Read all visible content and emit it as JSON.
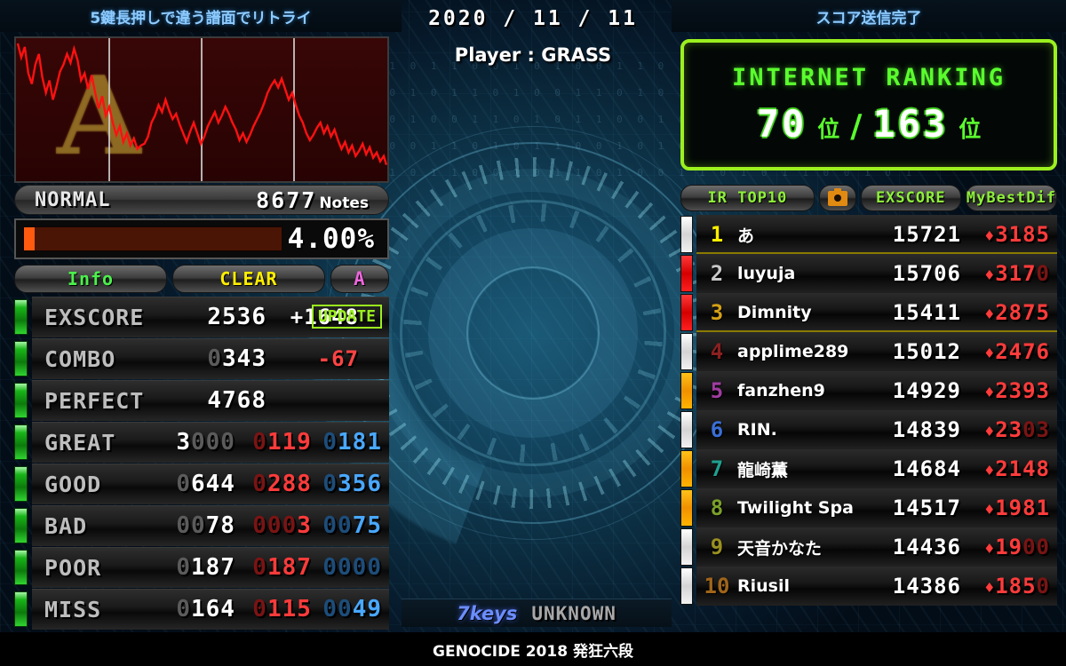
{
  "left": {
    "banner": "5鍵長押しで違う譜面でリトライ",
    "graph": {
      "grade_letter": "A",
      "gauge_type": "NORMAL",
      "notes_count": "8677",
      "notes_label": "Notes",
      "percent": "4.00%",
      "percent_fill": 4.0
    },
    "tabs": {
      "info": "Info",
      "clear": "CLEAR",
      "rank": "A"
    },
    "stats": [
      {
        "label": "EXSCORE",
        "value": "2536",
        "value_dim": "",
        "diff": "+1648",
        "diff_sign": "plus",
        "red": "",
        "red_dim": "",
        "blue": "",
        "blue_dim": "",
        "badge": "UPDATE"
      },
      {
        "label": "COMBO",
        "value": "343",
        "value_dim": "0",
        "diff": "-67",
        "diff_sign": "minus",
        "red": "",
        "red_dim": "",
        "blue": "",
        "blue_dim": "",
        "badge": ""
      },
      {
        "label": "PERFECT",
        "value": "4768",
        "value_dim": "",
        "diff": "",
        "diff_sign": "",
        "red": "",
        "red_dim": "",
        "blue": "",
        "blue_dim": "",
        "badge": ""
      },
      {
        "label": "GREAT",
        "value": "3",
        "value_dim": "",
        "value_dim_after": "000",
        "diff": "",
        "diff_sign": "",
        "red": "119",
        "red_dim": "0",
        "blue": "181",
        "blue_dim": "0",
        "badge": ""
      },
      {
        "label": "GOOD",
        "value": "644",
        "value_dim": "0",
        "diff": "",
        "diff_sign": "",
        "red": "288",
        "red_dim": "0",
        "blue": "356",
        "blue_dim": "0",
        "badge": ""
      },
      {
        "label": "BAD",
        "value": "78",
        "value_dim": "00",
        "diff": "",
        "diff_sign": "",
        "red": "3",
        "red_dim": "000",
        "blue": "75",
        "blue_dim": "00",
        "badge": ""
      },
      {
        "label": "POOR",
        "value": "187",
        "value_dim": "0",
        "diff": "",
        "diff_sign": "",
        "red": "187",
        "red_dim": "0",
        "blue": "",
        "blue_dim": "0000",
        "badge": ""
      },
      {
        "label": "MISS",
        "value": "164",
        "value_dim": "0",
        "diff": "",
        "diff_sign": "",
        "red": "115",
        "red_dim": "0",
        "blue": "49",
        "blue_dim": "00",
        "badge": ""
      }
    ]
  },
  "center": {
    "date": "2020 / 11 / 11",
    "player": "Player : GRASS",
    "keys": "7keys",
    "difficulty": "UNKNOWN",
    "song_title": "GENOCIDE 2018 発狂六段"
  },
  "right": {
    "banner": "スコア送信完了",
    "internet_ranking": {
      "title": "INTERNET RANKING",
      "my_rank": "70",
      "total": "163",
      "unit": "位",
      "separator": "/"
    },
    "ir_header": {
      "top10": "IR TOP10",
      "camera": "camera-icon",
      "exscore": "EXSCORE",
      "mybestdif": "MyBestDif"
    },
    "ranking": [
      {
        "rank": "1",
        "name": "あ",
        "score": "15721",
        "dif": "3185",
        "dif_dim": "",
        "bar": "cb-white",
        "rank_color": "#ffee00",
        "highlight": true
      },
      {
        "rank": "2",
        "name": "luyuja",
        "score": "15706",
        "dif": "317",
        "dif_dim": "0",
        "bar": "cb-red",
        "rank_color": "#c8c8c8",
        "highlight": false,
        "score_dim_idx": 3
      },
      {
        "rank": "3",
        "name": "Dimnity",
        "score": "15411",
        "dif": "2875",
        "dif_dim": "",
        "bar": "cb-red",
        "rank_color": "#d4a017",
        "highlight": true
      },
      {
        "rank": "4",
        "name": "applime289",
        "score": "15012",
        "dif": "2476",
        "dif_dim": "",
        "bar": "cb-white",
        "rank_color": "#8b2020",
        "highlight": false
      },
      {
        "rank": "5",
        "name": "fanzhen9",
        "score": "14929",
        "dif": "2393",
        "dif_dim": "",
        "bar": "cb-orange",
        "rank_color": "#a03ca0",
        "highlight": false
      },
      {
        "rank": "6",
        "name": "RIN.",
        "score": "14839",
        "dif": "23",
        "dif_dim": "03",
        "bar": "cb-white",
        "rank_color": "#3a6fd8",
        "highlight": false
      },
      {
        "rank": "7",
        "name": "龍崎薫",
        "score": "14684",
        "dif": "2148",
        "dif_dim": "",
        "bar": "cb-orange",
        "rank_color": "#20a090",
        "highlight": false
      },
      {
        "rank": "8",
        "name": "Twilight Sparkle",
        "score": "14517",
        "dif": "1981",
        "dif_dim": "",
        "bar": "cb-orange",
        "rank_color": "#7aa02a",
        "highlight": false
      },
      {
        "rank": "9",
        "name": "天音かなた",
        "score": "14436",
        "dif": "19",
        "dif_dim": "00",
        "bar": "cb-white",
        "rank_color": "#9a9020",
        "highlight": false
      },
      {
        "rank": "10",
        "name": "Riusil",
        "score": "14386",
        "dif": "185",
        "dif_dim": "0",
        "bar": "cb-white",
        "rank_color": "#a0651a",
        "highlight": false
      }
    ]
  },
  "colors": {
    "accent_green": "#9bf01e",
    "accent_blue": "#8ecbff",
    "red": "#ff3b3b",
    "blue": "#49a8ff",
    "yellow": "#ffee00"
  },
  "bg_code": "0 1 0 1 1 0 0 1 0 1 1 0 1 0 0 1 1 0 1 0 1 1 0 0 1 0 1 0 0 1 1 0 1 0 1 1 0 0 1 0 1 1 0 1 0 0 1 1 0 1 0 1 1 0 0 1 0 1 0 0 1 1 0 1 0 1 1 0 0 1 0 1 1 0 1 0 0 1 1 0 1 0 1 1 0 0 1 0 1 0 0 1 1 0 1 0 1 1 0 0 1 0 1 1 0 1 0 0 1 1 0 1 0 1 1 0 0 1 0 1 0 0 1 1 0 1 0 1 1 0 0 1 0 1 1 0 1 0 0 1 1 0 1 0 1 1 0 0 1 0 1 0 0 1 1 0 1 0 1 1 0 0 1 0 1 1 0 1 0 0 1 1 0 1 0 1 1 0 0 1 0 1 0 0 1 1 0 1 0 1 1 0 0 1 0 1 1 0 1 0 0 1 1 0 1 0 1 1 0 0 1 0 1 0 0 1 1 0 1 0 1 1 0 0 1 0 1 1 0 1 0 0 1 1 0 1 0 1 1 0 0 1 0 1"
}
